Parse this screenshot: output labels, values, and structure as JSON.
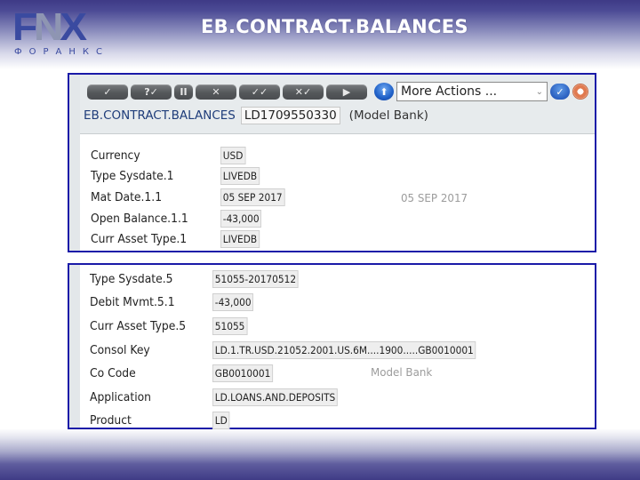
{
  "header": {
    "logo_mark": "FNX",
    "logo_subtitle": "ФОРАНКС",
    "title": "EB.CONTRACT.BALANCES"
  },
  "toolbar": {
    "buttons": [
      {
        "name": "commit-button",
        "glyph": "✓"
      },
      {
        "name": "validate-button",
        "glyph": "?✓"
      },
      {
        "name": "hold-button",
        "glyph": "II"
      },
      {
        "name": "delete-button",
        "glyph": "✕"
      },
      {
        "name": "authorise-button",
        "glyph": "✓✓"
      },
      {
        "name": "reverse-button",
        "glyph": "✕✓"
      },
      {
        "name": "next-button",
        "glyph": "▶"
      }
    ],
    "upload_glyph": "⬆",
    "more_actions": "More Actions ...",
    "more_actions_chevron": "⌄",
    "go_glyph": "✓"
  },
  "record": {
    "application": "EB.CONTRACT.BALANCES",
    "id": "LD1709550330",
    "company": "(Model Bank)"
  },
  "top_fields": [
    {
      "label": "Currency",
      "value": "USD"
    },
    {
      "label": "Type Sysdate.1",
      "value": "LIVEDB"
    },
    {
      "label": "Mat Date.1.1",
      "value": "05 SEP 2017",
      "note": "05 SEP 2017"
    },
    {
      "label": "Open Balance.1.1",
      "value": "-43,000"
    },
    {
      "label": "Curr Asset Type.1",
      "value": "LIVEDB"
    }
  ],
  "bottom_fields": [
    {
      "label": "Type Sysdate.5",
      "value": "51055-20170512"
    },
    {
      "label": "Debit Mvmt.5.1",
      "value": "-43,000"
    },
    {
      "label": "Curr Asset Type.5",
      "value": "51055"
    },
    {
      "label": "Consol Key",
      "value": "LD.1.TR.USD.21052.2001.US.6M....1900.....GB0010001"
    },
    {
      "label": "Co Code",
      "value": "GB0010001",
      "note": "Model Bank"
    },
    {
      "label": "Application",
      "value": "LD.LOANS.AND.DEPOSITS"
    },
    {
      "label": "Product",
      "value": "LD"
    }
  ],
  "colors": {
    "panel_border": "#1a1aa8",
    "header_band": "#3e3a86",
    "app_name": "#1f3d7a",
    "note_text": "#9c9c9c"
  }
}
